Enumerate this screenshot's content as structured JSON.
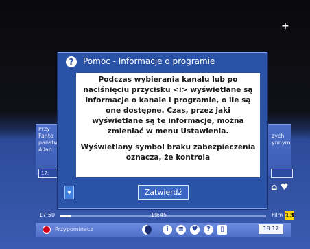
{
  "dialog": {
    "title": "Pomoc - Informacje o programie",
    "paragraph1": "Podczas wybierania kanału lub po naciśnięciu przycisku <i> wyświetlane są informacje o kanale i programie, o ile są one dostępne. Czas, przez jaki wyświetlane są te informacje, można zmieniać w menu Ustawienia.",
    "paragraph2": "Wyświetlany symbol braku zabezpieczenia oznacza, że kontrola",
    "ok_label": "Zatwierdź",
    "question_icon": "?",
    "scroll_icon": "▼"
  },
  "background": {
    "top_symbol": "+",
    "info_left": "Przy\nFanto\npaństw\nAllan",
    "info_right": "zych\nynnym",
    "time_box_label": "17:"
  },
  "progress": {
    "start_time": "17:50",
    "end_time": "19:45",
    "progress_value": 0.05,
    "genre": "Film",
    "age_rating": "13"
  },
  "status_bar": {
    "reminder": "Przypominacz",
    "clock": "18:17",
    "icons": [
      "record-icon",
      "talk-icon",
      "info-icon",
      "list-icon",
      "heart-icon",
      "help-icon",
      "card-icon"
    ]
  },
  "colors": {
    "accent": "#2a53a8",
    "badge": "#ffd400",
    "record": "#d4001a"
  }
}
